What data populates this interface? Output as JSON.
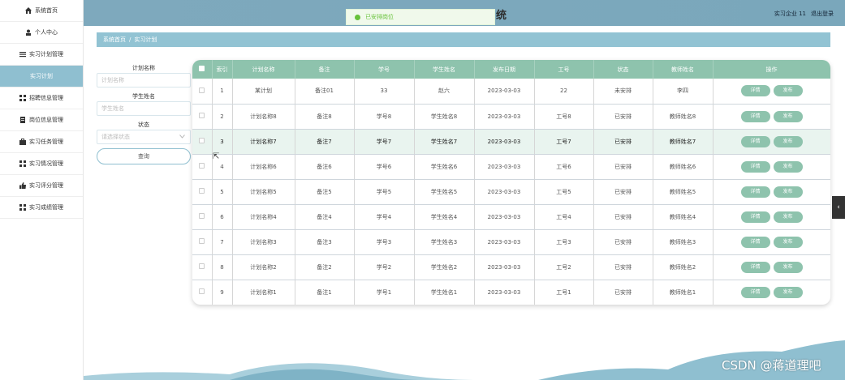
{
  "header": {
    "title": "统",
    "user_label": "实习企业 11",
    "logout_label": "退出登录"
  },
  "toast": {
    "message": "已安排岗位"
  },
  "breadcrumb": {
    "home": "系统首页",
    "separator": "/",
    "current": "实习计划"
  },
  "sidebar": {
    "items": [
      {
        "label": "系统首页",
        "icon": "home-icon"
      },
      {
        "label": "个人中心",
        "icon": "user-icon"
      },
      {
        "label": "实习计划管理",
        "icon": "menu-icon"
      },
      {
        "label": "实习计划",
        "icon": ""
      },
      {
        "label": "招聘信息管理",
        "icon": "grid-icon"
      },
      {
        "label": "岗位信息管理",
        "icon": "doc-icon"
      },
      {
        "label": "实习任务管理",
        "icon": "case-icon"
      },
      {
        "label": "实习情况管理",
        "icon": "grid-icon"
      },
      {
        "label": "实习评分管理",
        "icon": "thumb-icon"
      },
      {
        "label": "实习成绩管理",
        "icon": "grid-icon"
      }
    ]
  },
  "search": {
    "plan_name_label": "计划名称",
    "plan_name_placeholder": "计划名称",
    "student_name_label": "学生姓名",
    "student_name_placeholder": "学生姓名",
    "status_label": "状态",
    "status_placeholder": "请选择状态",
    "query_button": "查询"
  },
  "table": {
    "columns": [
      "索引",
      "计划名称",
      "备注",
      "学号",
      "学生姓名",
      "发布日期",
      "工号",
      "状态",
      "教师姓名",
      "操作"
    ],
    "detail_label": "详情",
    "publish_label": "发布",
    "rows": [
      {
        "index": "1",
        "plan": "某计划",
        "remark": "备注01",
        "student_no": "33",
        "student": "赵六",
        "date": "2023-03-03",
        "job_no": "22",
        "status": "未安排",
        "teacher": "李四"
      },
      {
        "index": "2",
        "plan": "计划名称8",
        "remark": "备注8",
        "student_no": "学号8",
        "student": "学生姓名8",
        "date": "2023-03-03",
        "job_no": "工号8",
        "status": "已安排",
        "teacher": "教师姓名8"
      },
      {
        "index": "3",
        "plan": "计划名称7",
        "remark": "备注7",
        "student_no": "学号7",
        "student": "学生姓名7",
        "date": "2023-03-03",
        "job_no": "工号7",
        "status": "已安排",
        "teacher": "教师姓名7"
      },
      {
        "index": "4",
        "plan": "计划名称6",
        "remark": "备注6",
        "student_no": "学号6",
        "student": "学生姓名6",
        "date": "2023-03-03",
        "job_no": "工号6",
        "status": "已安排",
        "teacher": "教师姓名6"
      },
      {
        "index": "5",
        "plan": "计划名称5",
        "remark": "备注5",
        "student_no": "学号5",
        "student": "学生姓名5",
        "date": "2023-03-03",
        "job_no": "工号5",
        "status": "已安排",
        "teacher": "教师姓名5"
      },
      {
        "index": "6",
        "plan": "计划名称4",
        "remark": "备注4",
        "student_no": "学号4",
        "student": "学生姓名4",
        "date": "2023-03-03",
        "job_no": "工号4",
        "status": "已安排",
        "teacher": "教师姓名4"
      },
      {
        "index": "7",
        "plan": "计划名称3",
        "remark": "备注3",
        "student_no": "学号3",
        "student": "学生姓名3",
        "date": "2023-03-03",
        "job_no": "工号3",
        "status": "已安排",
        "teacher": "教师姓名3"
      },
      {
        "index": "8",
        "plan": "计划名称2",
        "remark": "备注2",
        "student_no": "学号2",
        "student": "学生姓名2",
        "date": "2023-03-03",
        "job_no": "工号2",
        "status": "已安排",
        "teacher": "教师姓名2"
      },
      {
        "index": "9",
        "plan": "计划名称1",
        "remark": "备注1",
        "student_no": "学号1",
        "student": "学生姓名1",
        "date": "2023-03-03",
        "job_no": "工号1",
        "status": "已安排",
        "teacher": "教师姓名1"
      }
    ]
  },
  "watermark": "CSDN @蒋道理吧",
  "colors": {
    "accent": "#8ec3ad",
    "header": "#7ea9bd",
    "active_nav": "#8fbfd0"
  }
}
